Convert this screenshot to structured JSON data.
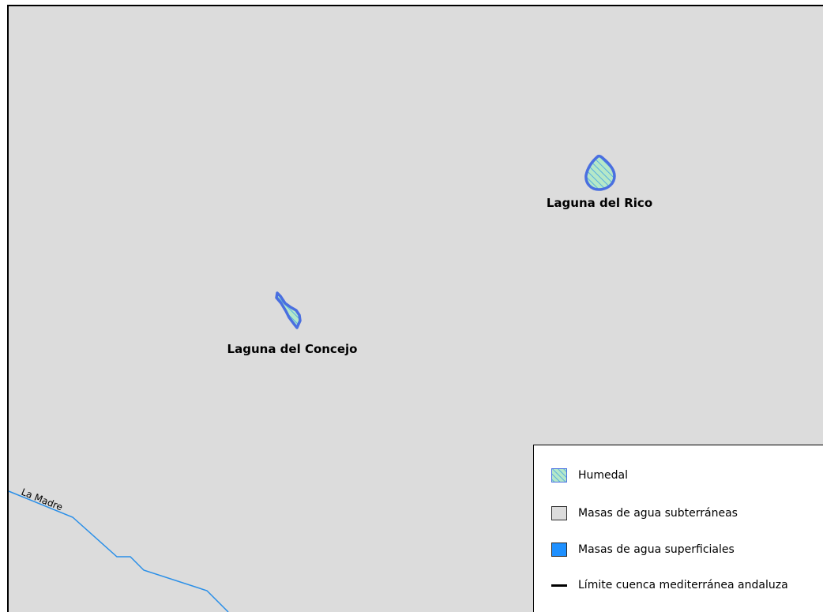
{
  "map": {
    "wetlands": [
      {
        "name": "Laguna del Rico"
      },
      {
        "name": "Laguna del Concejo"
      }
    ],
    "river": {
      "name": "La Madre"
    }
  },
  "legend": {
    "items": [
      {
        "label": "Humedal",
        "symbol": "hatched-fill",
        "fill_color": "#b5e8c8",
        "hatch_color": "#5ab0e0",
        "outline_color": "#4a6fe0"
      },
      {
        "label": "Masas de agua subterráneas",
        "symbol": "fill",
        "fill_color": "#dcdcdc"
      },
      {
        "label": "Masas de agua superficiales",
        "symbol": "fill",
        "fill_color": "#1e90ff"
      },
      {
        "label": "Límite cuenca mediterránea andaluza",
        "symbol": "line",
        "line_color": "#000000"
      }
    ]
  },
  "colors": {
    "background": "#dcdcdc",
    "river": "#2a8fe8",
    "wetland_outline": "#4a6fe0"
  }
}
